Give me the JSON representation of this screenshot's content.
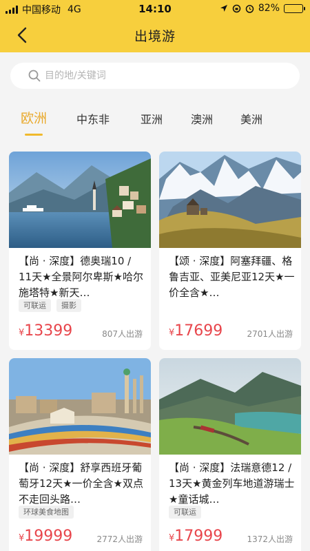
{
  "status_bar": {
    "carrier": "中国移动",
    "network": "4G",
    "time": "14:10",
    "battery": "82%",
    "battery_level": 0.82
  },
  "header": {
    "title": "出境游",
    "back_icon": "chevron-left-icon"
  },
  "search": {
    "placeholder": "目的地/关键词",
    "icon": "search-icon"
  },
  "tabs": [
    {
      "label": "欧洲",
      "active": true
    },
    {
      "label": "中东非",
      "active": false
    },
    {
      "label": "亚洲",
      "active": false
    },
    {
      "label": "澳洲",
      "active": false
    },
    {
      "label": "美洲",
      "active": false
    }
  ],
  "products": [
    {
      "title": "【尚 · 深度】德奥瑞10 / 11天★全景阿尔卑斯★哈尔施塔特★新天…",
      "tags": [
        "可联运",
        "摄影"
      ],
      "currency": "¥",
      "price": "13399",
      "sold": "807人出游"
    },
    {
      "title": "【颂 · 深度】阿塞拜疆、格鲁吉亚、亚美尼亚12天★一价全含★…",
      "tags": [],
      "currency": "¥",
      "price": "17699",
      "sold": "2701人出游"
    },
    {
      "title": "【尚 · 深度】舒享西班牙葡萄牙12天★一价全含★双点不走回头路…",
      "tags": [
        "环球美食地图"
      ],
      "currency": "¥",
      "price": "19999",
      "sold": "2772人出游"
    },
    {
      "title": "【尚 · 深度】法瑞意德12 / 13天★黄金列车地道游瑞士★童话城…",
      "tags": [
        "可联运"
      ],
      "currency": "¥",
      "price": "17999",
      "sold": "1372人出游"
    }
  ],
  "colors": {
    "header_bg": "#f7cf3d",
    "tab_active": "#e9a92b",
    "price": "#e8464c"
  }
}
